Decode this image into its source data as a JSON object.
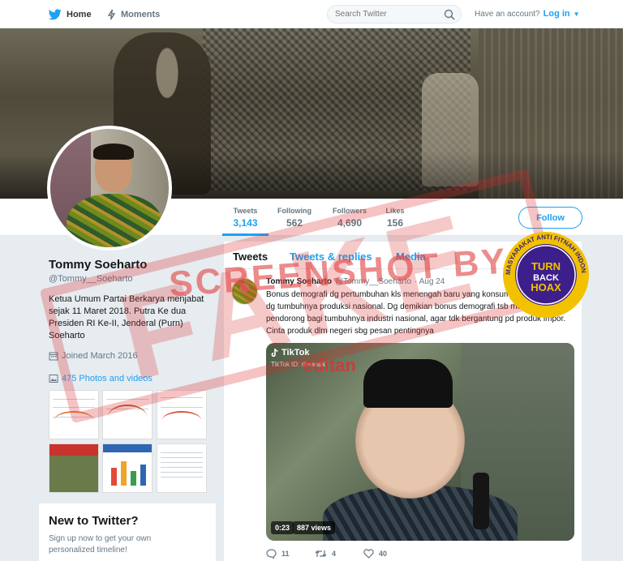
{
  "nav": {
    "home_label": "Home",
    "moments_label": "Moments",
    "search_placeholder": "Search Twitter",
    "account_prompt": "Have an account?",
    "login_label": "Log in"
  },
  "profile": {
    "name": "Tommy Soeharto",
    "handle": "@Tommy__Soeharto",
    "bio": "Ketua Umum Partai Berkarya menjabat sejak 11 Maret 2018. Putra Ke dua Presiden RI Ke-II, Jenderal (Purn) Soeharto",
    "joined": "Joined March 2016",
    "photos_link": "475 Photos and videos"
  },
  "stats": [
    {
      "label": "Tweets",
      "value": "3,143"
    },
    {
      "label": "Following",
      "value": "562"
    },
    {
      "label": "Followers",
      "value": "4,690"
    },
    {
      "label": "Likes",
      "value": "156"
    }
  ],
  "follow_label": "Follow",
  "tabs": [
    "Tweets",
    "Tweets & replies",
    "Media"
  ],
  "tweet": {
    "name": "Tommy Soeharto",
    "handle": "@Tommy__Soeharto",
    "date": "· Aug 24",
    "text": "Bonus demografi dg pertumbuhan kls menengah baru yang konsumtif harus diiringi dg tumbuhnya produksi nasional. Dg demikian bonus demografi tsb menjadi pendorong bagi tumbuhnya industri nasional, agar tdk bergantung pd produk impor. Cinta produk dlm negeri sbg pesan pentingnya",
    "video": {
      "brand": "TikTok",
      "tiktok_id": "TikTok ID: riksarisk",
      "duration": "0:23",
      "views": "887 views"
    },
    "replies": "11",
    "retweets": "4",
    "likes": "40"
  },
  "new_to_twitter": {
    "title": "New to Twitter?",
    "subtitle": "Sign up now to get your own personalized timeline!"
  },
  "overlay": {
    "stamp_text": "FAKE",
    "screenshot_by": "SCREENSHOT BY",
    "editor_label": "editan",
    "badge_top_text": "MASYARAKAT ANTI FITNAH INDONESIA",
    "badge_main": "TURN BACK HOAX"
  },
  "colors": {
    "accent": "#1da1f2",
    "stamp": "#dc2828",
    "badge_gold": "#f2c200",
    "badge_purple": "#3c1f8a"
  }
}
